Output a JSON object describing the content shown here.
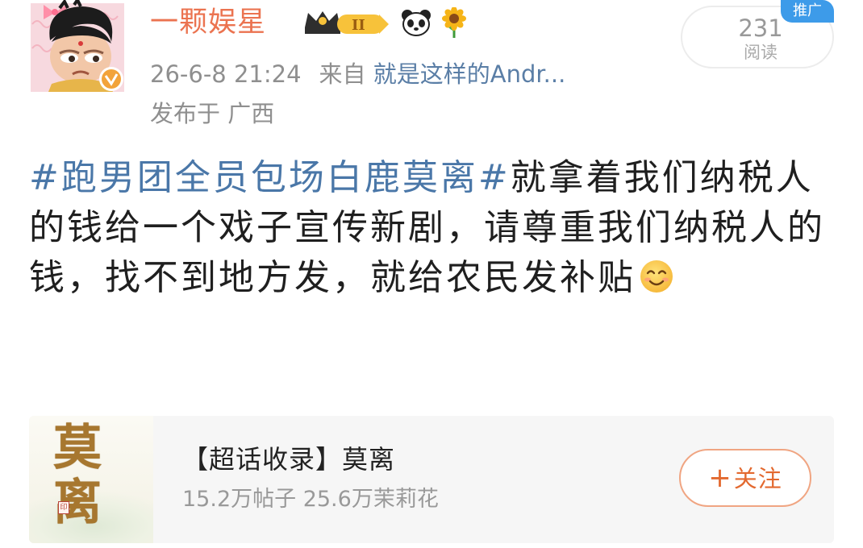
{
  "post_header": {
    "username": "一颗娱星",
    "timestamp": "26-6-8 21:24",
    "source_prefix": "来自",
    "source": "就是这样的Andr...",
    "location": "发布于 广西",
    "badges": [
      "crown-level-II-icon",
      "panda-icon",
      "sunflower-icon"
    ],
    "verified": true
  },
  "stats": {
    "read_count": "231",
    "read_label": "阅读",
    "promoted_label": "推广"
  },
  "post_body": {
    "hashtag": "#跑男团全员包场白鹿莫离#",
    "text": "就拿着我们纳税人的钱给一个戏子宣传新剧，请尊重我们纳税人的钱，找不到地方发，就给农民发补贴",
    "emoji": "smile-emoji-icon"
  },
  "supertopic_card": {
    "title": "【超话收录】莫离",
    "cover_text": "莫离",
    "stats": "15.2万帖子 25.6万茉莉花",
    "follow_label": "关注",
    "follow_plus": "+"
  },
  "colors": {
    "username": "#eb7350",
    "hashtag": "#4a77a8",
    "source_link": "#5a7ea6",
    "promo_badge": "#3d9be9",
    "follow_accent": "#e3692f"
  }
}
